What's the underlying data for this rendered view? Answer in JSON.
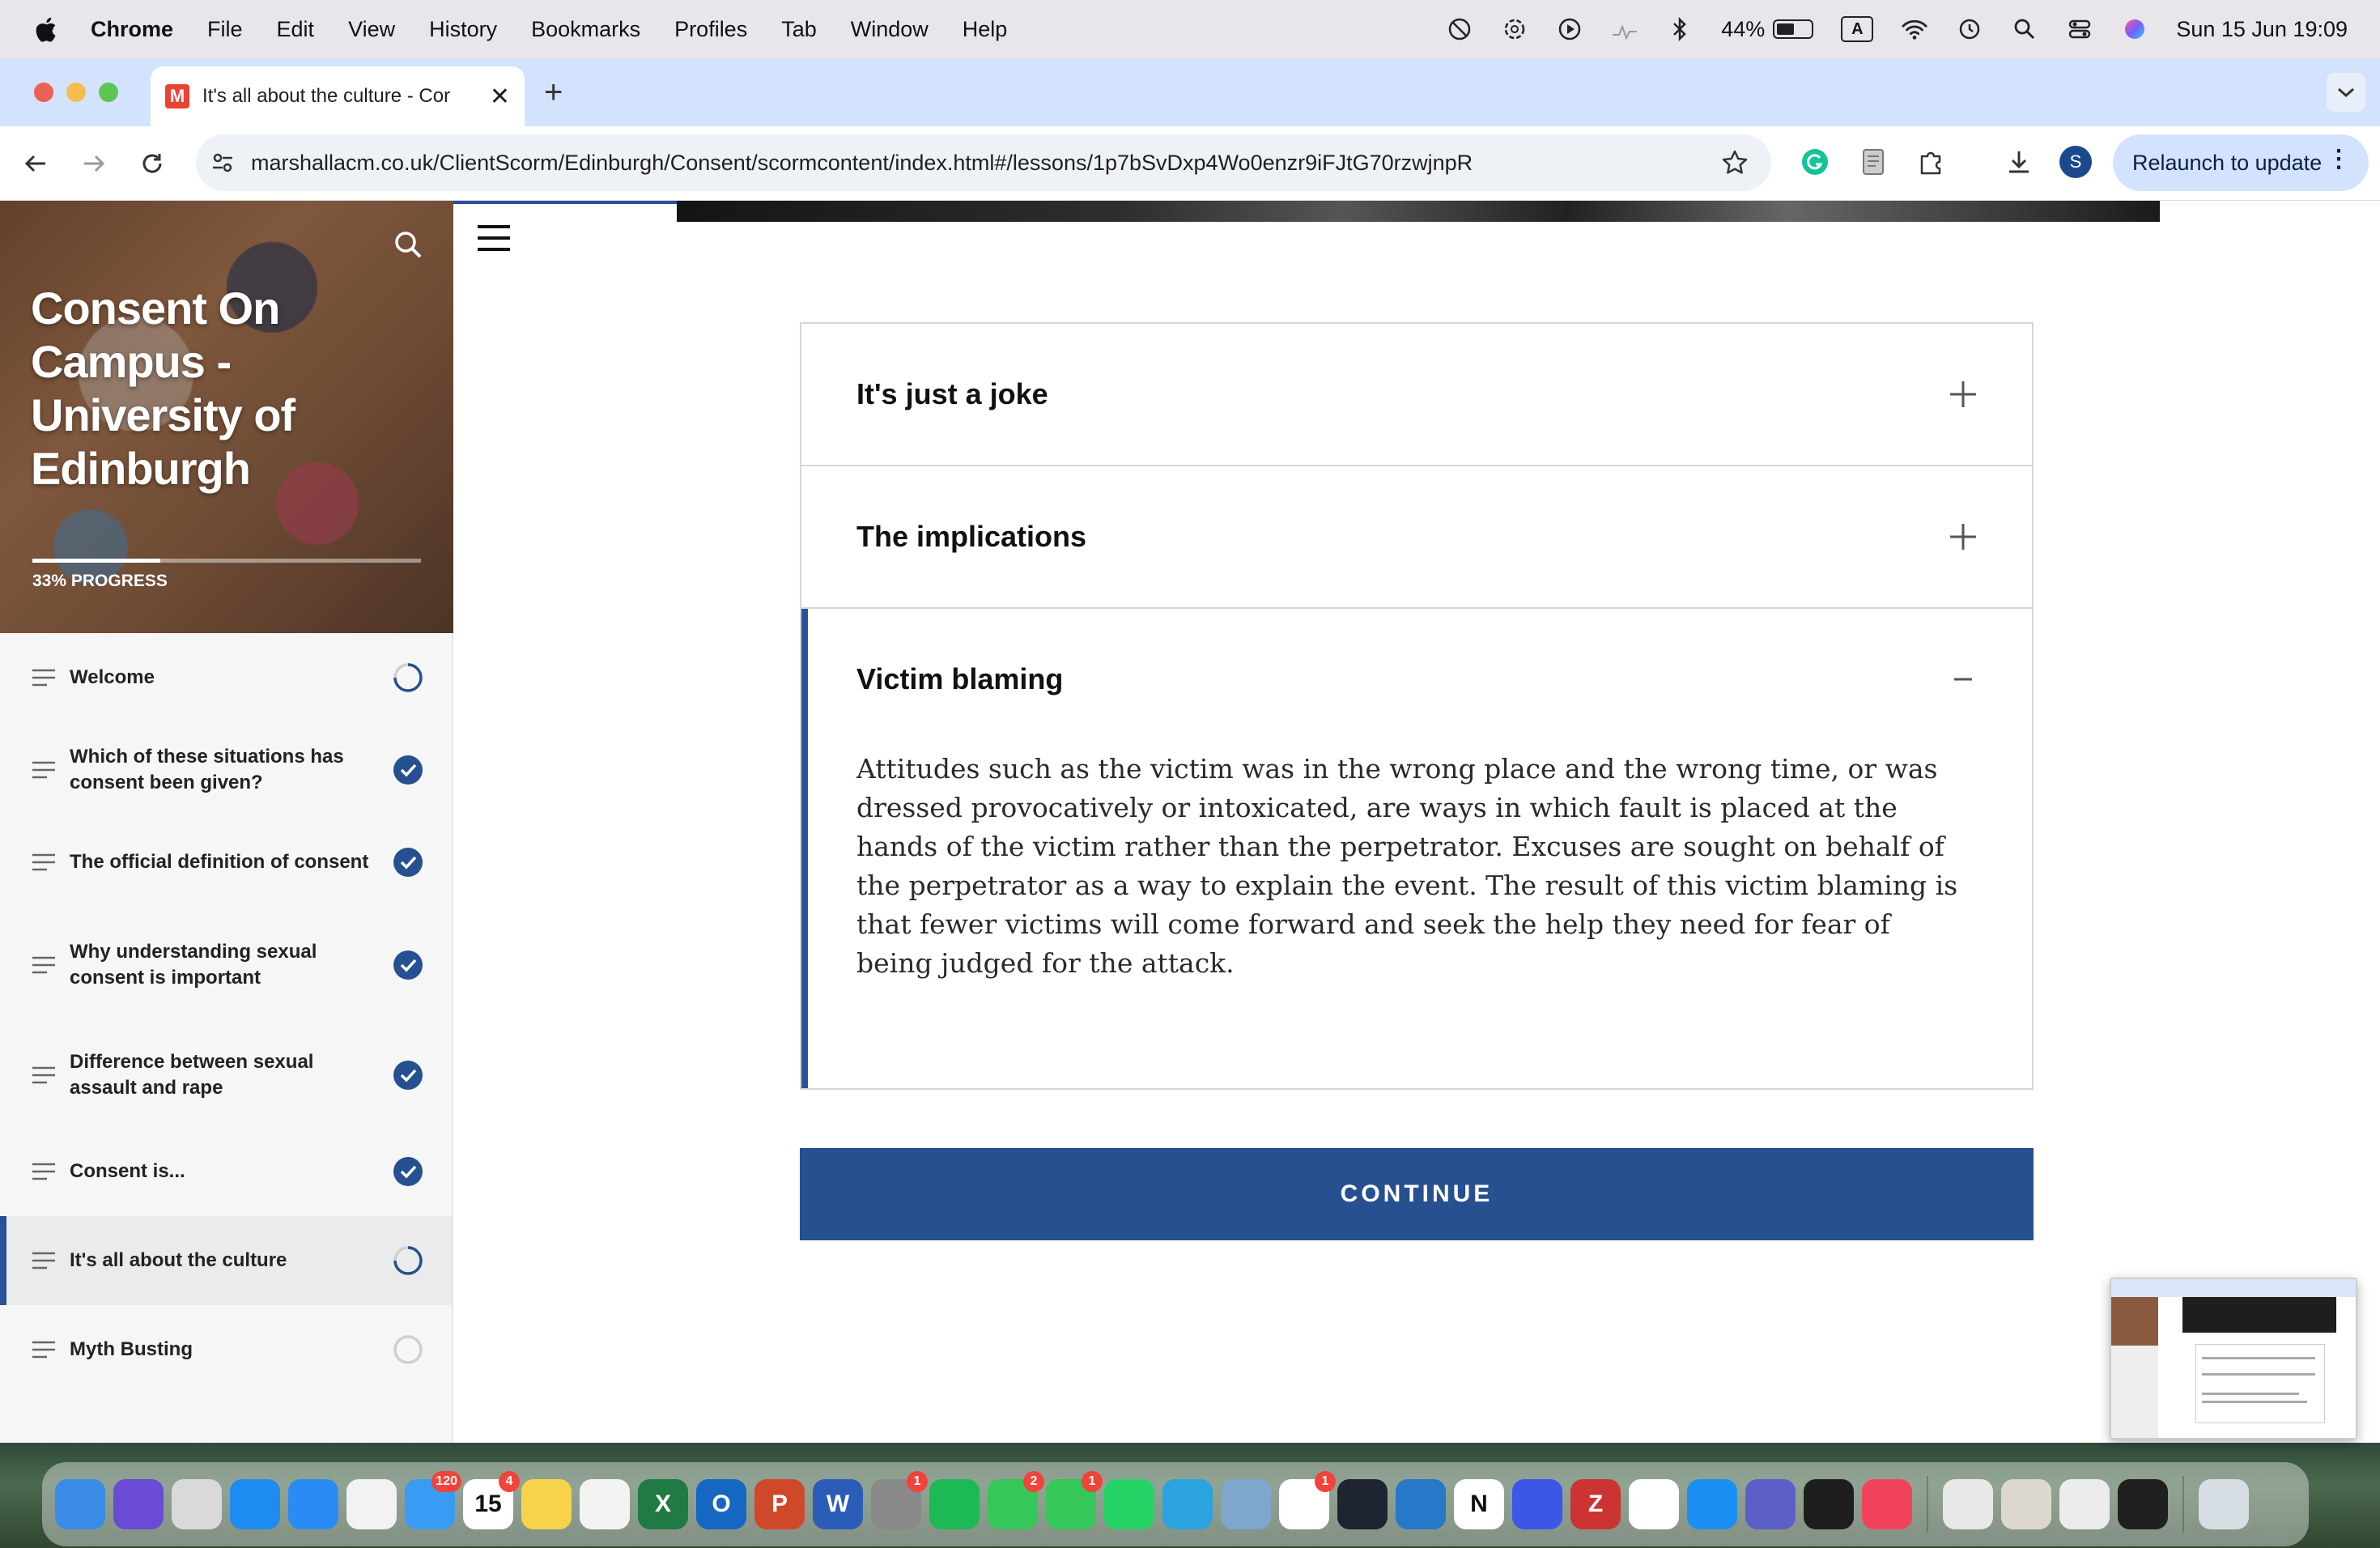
{
  "menubar": {
    "app_name": "Chrome",
    "items": [
      "File",
      "Edit",
      "View",
      "History",
      "Bookmarks",
      "Profiles",
      "Tab",
      "Window",
      "Help"
    ],
    "battery": "44%",
    "input_source": "A",
    "datetime": "Sun 15 Jun  19:09"
  },
  "browser": {
    "tab_title": "It's all about the culture - Cor",
    "tab_favicon": "M",
    "url": "marshallacm.co.uk/ClientScorm/Edinburgh/Consent/scormcontent/index.html#/lessons/1p7bSvDxp4Wo0enzr9iFJtG70rzwjnpR",
    "profile_initial": "S",
    "relaunch_label": "Relaunch to update"
  },
  "course": {
    "title": "Consent On Campus - University of Edinburgh",
    "progress_label": "33% PROGRESS",
    "progress_fraction": 0.33,
    "lessons": [
      {
        "label": "Welcome",
        "status": "in-progress"
      },
      {
        "label": "Which of these situations has consent been given?",
        "status": "complete"
      },
      {
        "label": "The official definition of consent",
        "status": "complete"
      },
      {
        "label": "Why understanding sexual consent is important",
        "status": "complete"
      },
      {
        "label": "Difference between sexual assault and rape",
        "status": "complete"
      },
      {
        "label": "Consent is...",
        "status": "complete"
      },
      {
        "label": "It's all about the culture",
        "status": "in-progress"
      },
      {
        "label": "Myth Busting",
        "status": "not-started"
      }
    ]
  },
  "accordion": {
    "items": [
      {
        "title": "It's just a joke",
        "expanded": false
      },
      {
        "title": "The implications",
        "expanded": false
      },
      {
        "title": "Victim blaming",
        "expanded": true,
        "body": "Attitudes such as the victim was in the wrong place and the wrong time, or was dressed provocatively or intoxicated, are ways in which fault is placed at the hands of the victim rather than the perpetrator.  Excuses are sought on behalf of the perpetrator as a way to explain the event.  The result of this victim blaming is that fewer victims will come forward and seek the help they need for fear of being judged for the attack."
      }
    ]
  },
  "continue_label": "CONTINUE",
  "colors": {
    "accent": "#26508f",
    "chrome_tab_strip": "#d3e3fd"
  },
  "dock": {
    "apps": [
      {
        "name": "finder-icon",
        "color": "#3b8be8"
      },
      {
        "name": "siri-icon",
        "color": "#6a4bd6"
      },
      {
        "name": "launchpad-icon",
        "color": "#d9d9d9"
      },
      {
        "name": "app-store-icon",
        "color": "#1e8bf0"
      },
      {
        "name": "safari-icon",
        "color": "#2a8cf2"
      },
      {
        "name": "chrome-icon",
        "color": "#f2f2f2"
      },
      {
        "name": "mail-icon",
        "color": "#3a9bf4",
        "badge": "120"
      },
      {
        "name": "calendar-icon",
        "color": "#ffffff",
        "badge": "4",
        "text": "15"
      },
      {
        "name": "notes-icon",
        "color": "#f7d34c"
      },
      {
        "name": "photos-icon",
        "color": "#f3f3f3"
      },
      {
        "name": "excel-icon",
        "color": "#1f7a43",
        "text": "X"
      },
      {
        "name": "outlook-icon",
        "color": "#1667c3",
        "text": "O"
      },
      {
        "name": "powerpoint-icon",
        "color": "#d0482a",
        "text": "P"
      },
      {
        "name": "word-icon",
        "color": "#2b5cb8",
        "text": "W"
      },
      {
        "name": "system-settings-icon",
        "color": "#8a8a8a",
        "badge": "1"
      },
      {
        "name": "spotify-icon",
        "color": "#1db954"
      },
      {
        "name": "messages-icon",
        "color": "#35c759",
        "badge": "2"
      },
      {
        "name": "facetime-icon",
        "color": "#35c759",
        "badge": "1"
      },
      {
        "name": "whatsapp-icon",
        "color": "#25d366"
      },
      {
        "name": "telegram-icon",
        "color": "#2aa3df"
      },
      {
        "name": "preview-icon",
        "color": "#7fa6cc"
      },
      {
        "name": "slack-icon",
        "color": "#ffffff",
        "badge": "1"
      },
      {
        "name": "cursor-icon",
        "color": "#1e2430"
      },
      {
        "name": "vscode-icon",
        "color": "#2778c8"
      },
      {
        "name": "notion-icon",
        "color": "#ffffff",
        "text": "N"
      },
      {
        "name": "arc-icon",
        "color": "#3c57e8"
      },
      {
        "name": "zotero-icon",
        "color": "#cc3333",
        "text": "Z"
      },
      {
        "name": "chatgpt-icon",
        "color": "#ffffff"
      },
      {
        "name": "keynote-icon",
        "color": "#1c8ff2"
      },
      {
        "name": "teams-icon",
        "color": "#5b5fc7"
      },
      {
        "name": "activity-monitor-icon",
        "color": "#1e1e1e"
      },
      {
        "name": "music-icon",
        "color": "#f2435c"
      },
      {
        "name": "minimized-window-icon",
        "color": "#e8e8e8"
      },
      {
        "name": "minimized-window-icon",
        "color": "#dcd8d0"
      },
      {
        "name": "minimized-window-icon",
        "color": "#ececec"
      },
      {
        "name": "minimized-window-icon",
        "color": "#202020"
      },
      {
        "name": "trash-icon",
        "color": "#d6dde3"
      }
    ]
  }
}
